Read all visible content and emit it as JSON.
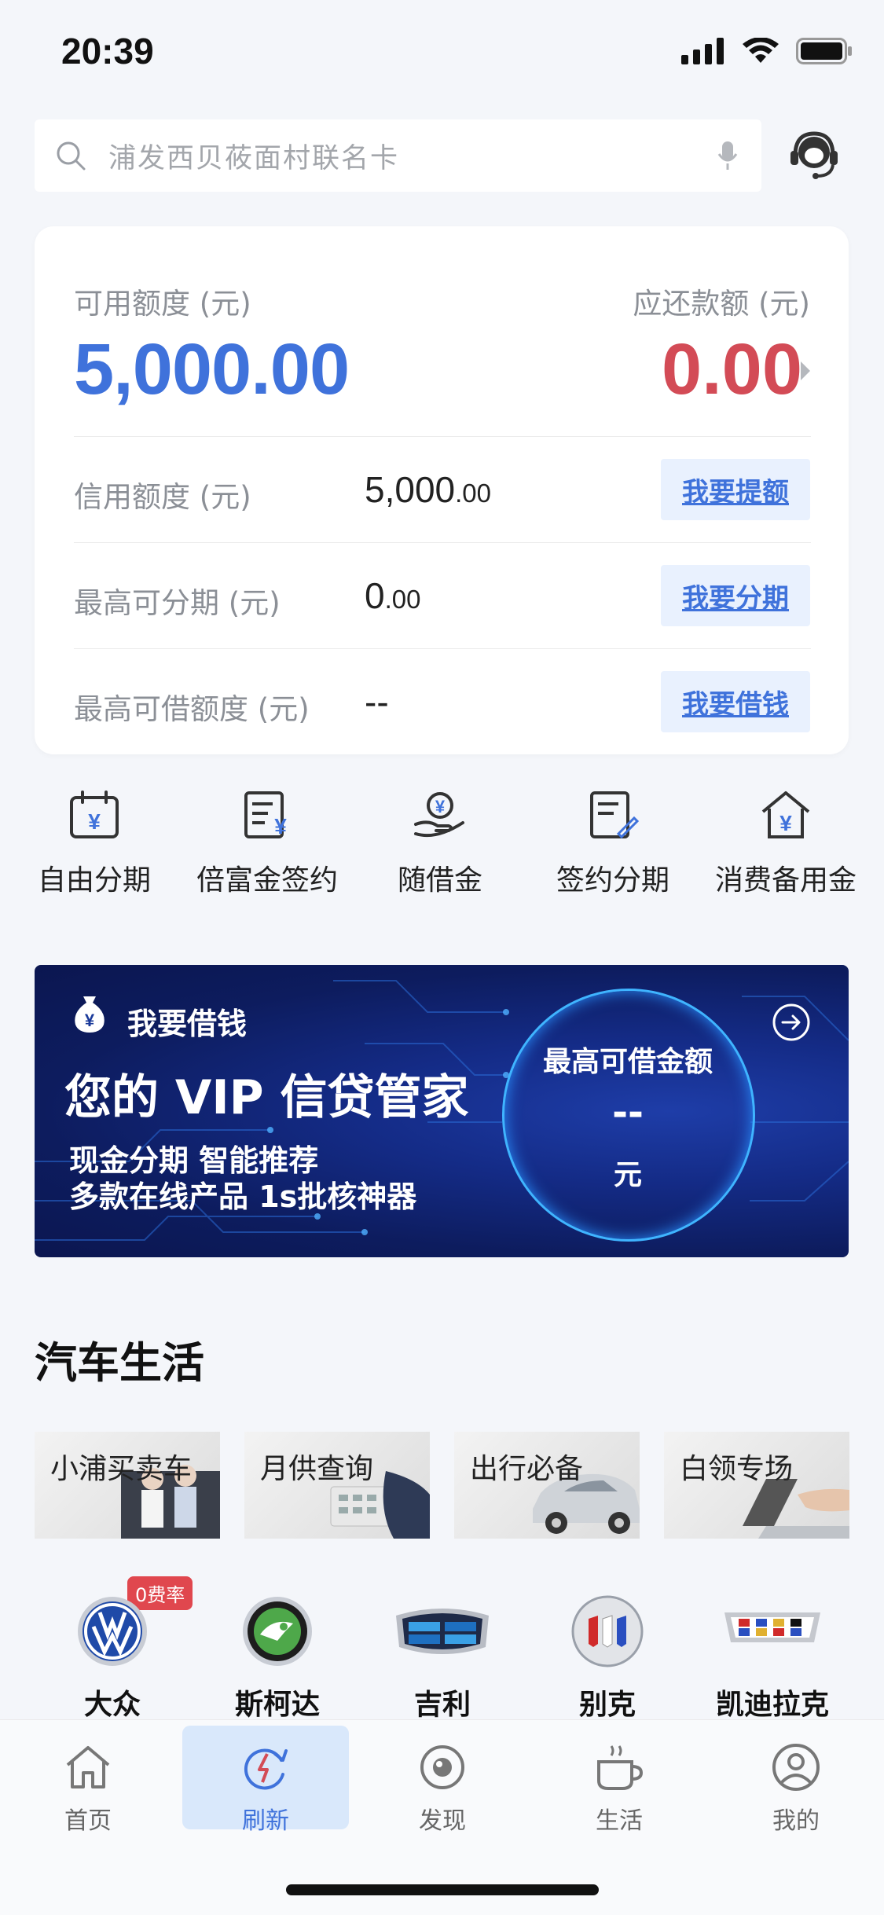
{
  "status": {
    "time": "20:39"
  },
  "search": {
    "placeholder": "浦发西贝莜面村联名卡"
  },
  "account": {
    "available_label": "可用额度 (元)",
    "available_value": "5,000.00",
    "repay_label": "应还款额 (元)",
    "repay_value": "0.00",
    "rows": [
      {
        "label": "信用额度 (元)",
        "value_int": "5,000",
        "value_dec": ".00",
        "button": "我要提额"
      },
      {
        "label": "最高可分期 (元)",
        "value_int": "0",
        "value_dec": ".00",
        "button": "我要分期"
      },
      {
        "label": "最高可借额度 (元)",
        "value_int": "--",
        "value_dec": "",
        "button": "我要借钱"
      }
    ]
  },
  "quick_menu": [
    {
      "label": "自由分期",
      "icon": "calendar-yuan-icon"
    },
    {
      "label": "倍富金签约",
      "icon": "document-yuan-icon"
    },
    {
      "label": "随借金",
      "icon": "hand-coin-icon"
    },
    {
      "label": "签约分期",
      "icon": "contract-pen-icon"
    },
    {
      "label": "消费备用金",
      "icon": "house-yuan-icon"
    }
  ],
  "banner": {
    "tag": "我要借钱",
    "headline": "您的 VIP 信贷管家",
    "sub1": "现金分期 智能推荐",
    "sub2": "多款在线产品 1s批核神器",
    "circle_title": "最高可借金额",
    "circle_value": "--",
    "circle_unit": "元"
  },
  "car_life": {
    "title": "汽车生活",
    "tiles": [
      "小浦买卖车",
      "月供查询",
      "出行必备",
      "白领专场"
    ],
    "brands": [
      {
        "name": "大众",
        "badge": "0费率"
      },
      {
        "name": "斯柯达"
      },
      {
        "name": "吉利"
      },
      {
        "name": "别克"
      },
      {
        "name": "凯迪拉克"
      }
    ]
  },
  "tabs": [
    {
      "label": "首页",
      "icon": "home-icon"
    },
    {
      "label": "刷新",
      "icon": "refresh-icon",
      "active": true
    },
    {
      "label": "发现",
      "icon": "discover-icon"
    },
    {
      "label": "生活",
      "icon": "cup-icon"
    },
    {
      "label": "我的",
      "icon": "profile-icon"
    }
  ],
  "colors": {
    "primary": "#3f72db",
    "red": "#d34b56",
    "banner": "#142b86"
  }
}
